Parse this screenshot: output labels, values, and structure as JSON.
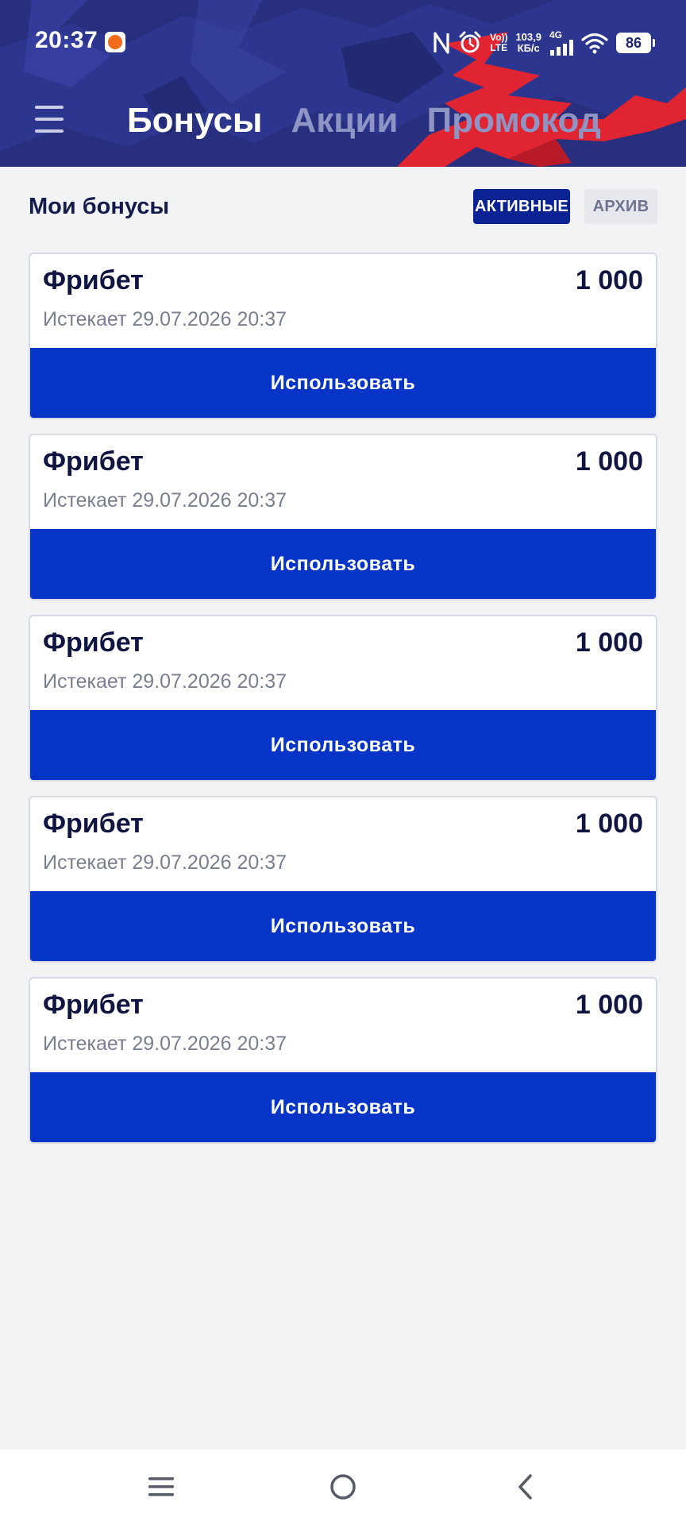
{
  "status_bar": {
    "time": "20:37",
    "network_type_top": "Vo))",
    "network_type_bottom": "LTE",
    "speed_value": "103,9",
    "speed_unit": "КБ/с",
    "mobile_gen": "4G",
    "battery": "86"
  },
  "nav": {
    "tabs": [
      {
        "label": "Бонусы",
        "active": true
      },
      {
        "label": "Акции",
        "active": false
      },
      {
        "label": "Промокод",
        "active": false
      }
    ]
  },
  "section": {
    "title": "Мои бонусы",
    "filter_active": "АКТИВНЫЕ",
    "filter_archive": "АРХИВ"
  },
  "bonuses": [
    {
      "title": "Фрибет",
      "amount": "1 000",
      "expiry": "Истекает 29.07.2026 20:37",
      "button": "Использовать"
    },
    {
      "title": "Фрибет",
      "amount": "1 000",
      "expiry": "Истекает 29.07.2026 20:37",
      "button": "Использовать"
    },
    {
      "title": "Фрибет",
      "amount": "1 000",
      "expiry": "Истекает 29.07.2026 20:37",
      "button": "Использовать"
    },
    {
      "title": "Фрибет",
      "amount": "1 000",
      "expiry": "Истекает 29.07.2026 20:37",
      "button": "Использовать"
    },
    {
      "title": "Фрибет",
      "amount": "1 000",
      "expiry": "Истекает 29.07.2026 20:37",
      "button": "Использовать"
    }
  ],
  "colors": {
    "header_bg": "#272f7e",
    "header_accent_red": "#e02432",
    "primary_button": "#0634c6",
    "filter_active_bg": "#0b2292",
    "page_bg": "#f2f3f5"
  },
  "icons": {
    "menu": "hamburger-menu-icon",
    "nfc": "nfc-icon",
    "alarm": "alarm-icon",
    "signal": "signal-bars-icon",
    "wifi": "wifi-icon",
    "battery": "battery-icon",
    "sys_recents": "recents-icon",
    "sys_home": "home-circle-icon",
    "sys_back": "back-chevron-icon"
  }
}
